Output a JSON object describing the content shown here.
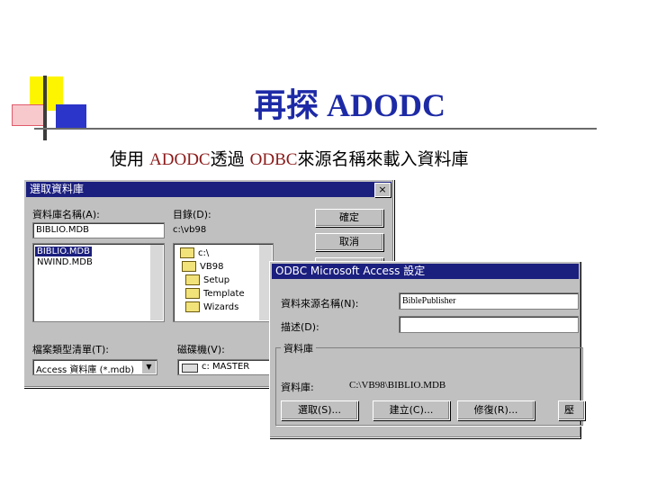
{
  "slide": {
    "title": "再探 ADODC",
    "subtitle_prefix": "使用 ",
    "subtitle_adodc": "ADODC",
    "subtitle_mid": "透過 ",
    "subtitle_odbc": "ODBC",
    "subtitle_suffix": "來源名稱來載入資料庫"
  },
  "select_db_dialog": {
    "title": "選取資料庫",
    "close_glyph": "×",
    "db_name_label": "資料庫名稱(A):",
    "db_name_value": "BIBLIO.MDB",
    "files": [
      "BIBLIO.MDB",
      "NWIND.MDB"
    ],
    "selected_file": "BIBLIO.MDB",
    "dir_label": "目錄(D):",
    "dir_value": "c:\\vb98",
    "folders": [
      "c:\\",
      "VB98",
      "Setup",
      "Template",
      "Wizards"
    ],
    "ok_label": "確定",
    "cancel_label": "取消",
    "filetype_label": "檔案類型清單(T):",
    "filetype_value": "Access 資料庫 (*.mdb)",
    "drive_label": "磁碟機(V):",
    "drive_value": "c: MASTER"
  },
  "odbc_dialog": {
    "title": "ODBC Microsoft Access 設定",
    "dsn_label": "資料來源名稱(N):",
    "dsn_value": "BiblePublisher",
    "desc_label": "描述(D):",
    "desc_value": "",
    "group_label": "資料庫",
    "db_label": "資料庫:",
    "db_path": "C:\\VB98\\BIBLIO.MDB",
    "select_label": "選取(S)...",
    "create_label": "建立(C)...",
    "repair_label": "修復(R)...",
    "compact_label": "壓"
  },
  "colors": {
    "title_blue": "#1d2aa6",
    "highlight_red": "#8b1a1a",
    "titlebar_navy": "#1b1f7e",
    "dialog_gray": "#c0c0c0"
  }
}
